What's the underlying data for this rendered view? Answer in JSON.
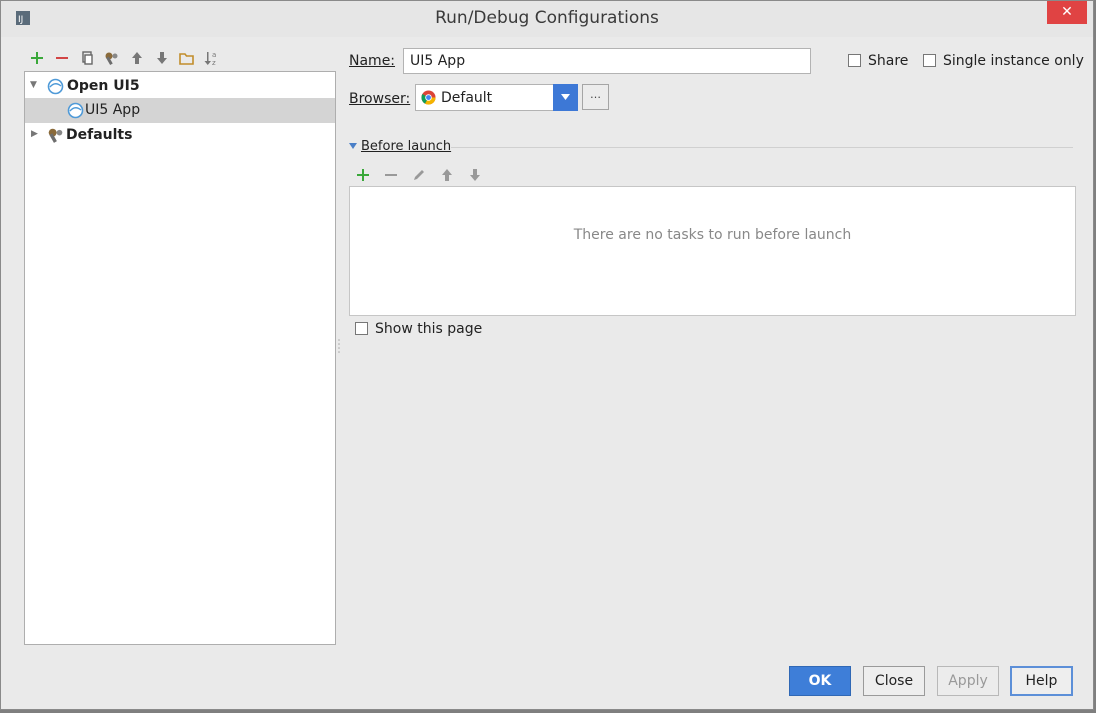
{
  "window": {
    "title": "Run/Debug Configurations",
    "close_glyph": "✕"
  },
  "toolbar": {
    "icons": [
      "add-icon",
      "remove-icon",
      "copy-icon",
      "wrench-icon",
      "move-up-icon",
      "move-down-icon",
      "folder-icon",
      "sort-icon"
    ]
  },
  "tree": {
    "items": [
      {
        "label": "Open UI5",
        "expanded": true,
        "bold": true,
        "icon": "ui5-icon"
      },
      {
        "label": "UI5 App",
        "selected": true,
        "icon": "ui5-icon"
      },
      {
        "label": "Defaults",
        "expanded": false,
        "bold": true,
        "icon": "wrench-icon"
      }
    ]
  },
  "form": {
    "name_label": "Name:",
    "name_value": "UI5 App",
    "share_label": "Share",
    "single_instance_label": "Single instance only",
    "browser_label": "Browser:",
    "browser_value": "Default",
    "browser_more": "…"
  },
  "before_launch": {
    "title": "Before launch",
    "empty_text": "There are no tasks to run before launch",
    "show_page_label": "Show this page"
  },
  "buttons": {
    "ok": "OK",
    "close": "Close",
    "apply": "Apply",
    "help": "Help"
  },
  "colors": {
    "accent": "#3e7ed8",
    "close_red": "#e04343",
    "selection": "#d4d4d4"
  }
}
